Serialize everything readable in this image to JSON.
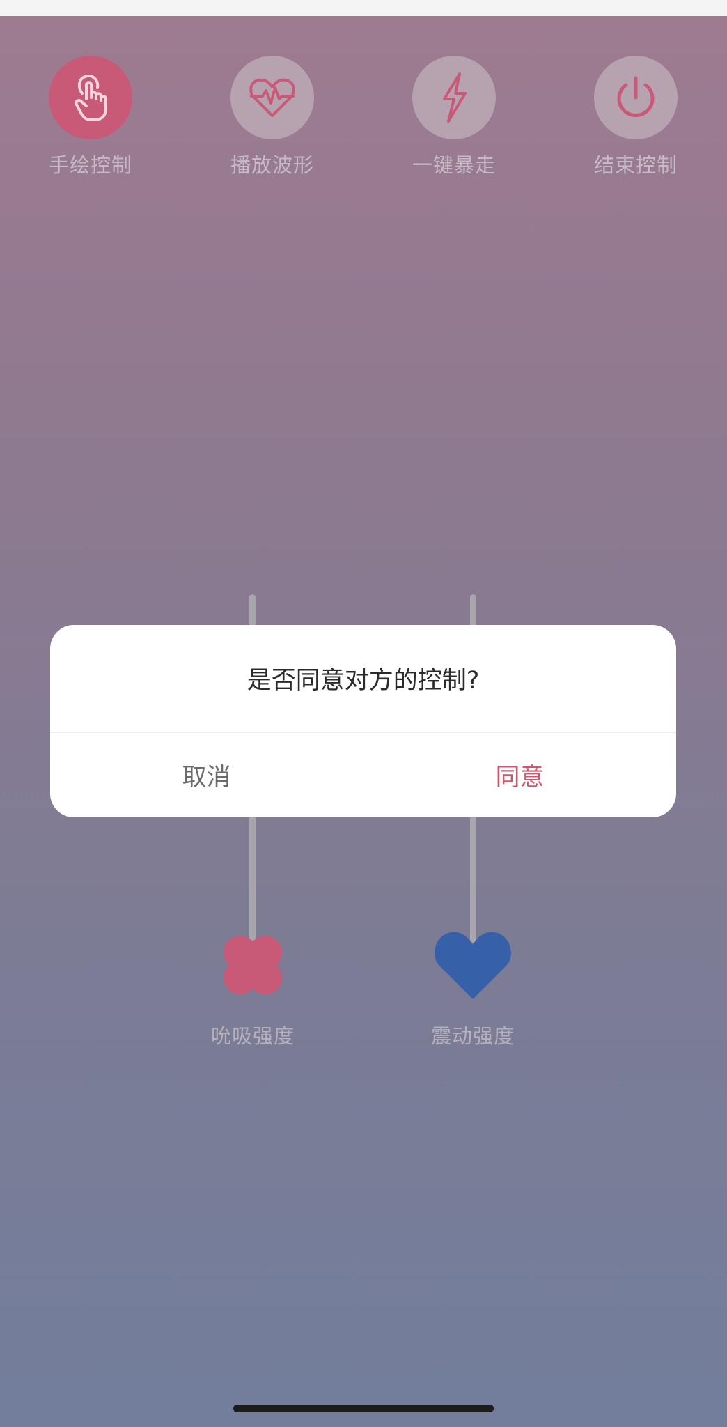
{
  "toolbar": {
    "items": [
      {
        "label": "手绘控制",
        "icon": "hand-pointer-icon",
        "active": true
      },
      {
        "label": "播放波形",
        "icon": "heart-pulse-icon",
        "active": false
      },
      {
        "label": "一键暴走",
        "icon": "lightning-icon",
        "active": false
      },
      {
        "label": "结束控制",
        "icon": "power-icon",
        "active": false
      }
    ]
  },
  "sliders": [
    {
      "label": "吮吸强度",
      "icon": "clover-icon",
      "color": "#c95a77"
    },
    {
      "label": "震动强度",
      "icon": "heart-icon",
      "color": "#3660a8"
    }
  ],
  "dialog": {
    "title": "是否同意对方的控制?",
    "cancel_label": "取消",
    "agree_label": "同意"
  },
  "colors": {
    "accent": "#d4546c",
    "active_tool": "#c95a77",
    "heart_blue": "#3660a8"
  }
}
